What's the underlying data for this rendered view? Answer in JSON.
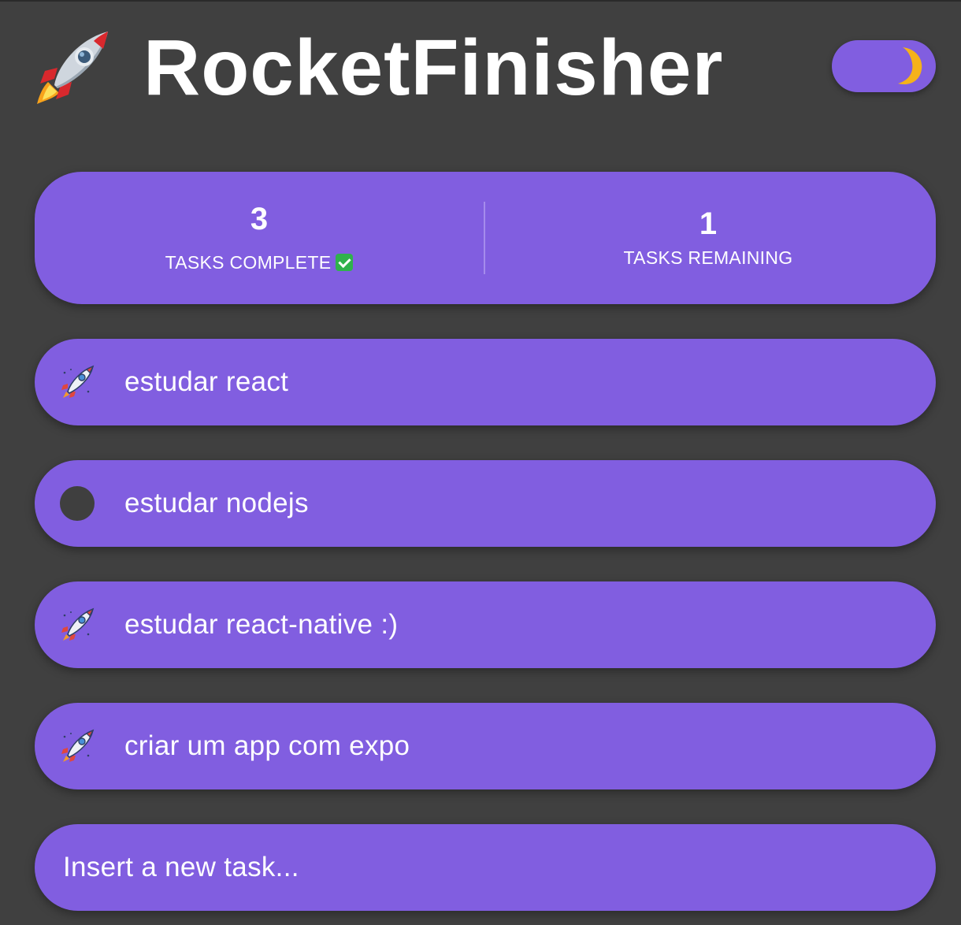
{
  "app": {
    "title": "RocketFinisher",
    "logo_icon": "rocket-icon",
    "theme_toggle_icon": "moon-icon",
    "theme": "dark"
  },
  "colors": {
    "background": "#404040",
    "accent": "#815ee0",
    "text": "#ffffff",
    "check_green": "#2fb24c",
    "moon": "#f5b21a"
  },
  "stats": {
    "complete": {
      "value": "3",
      "label": "TASKS COMPLETE",
      "icon": "check-mark-emoji"
    },
    "remaining": {
      "value": "1",
      "label": "TASKS REMAINING"
    }
  },
  "tasks": [
    {
      "text": "estudar react",
      "done": true,
      "icon": "rocket-icon"
    },
    {
      "text": "estudar nodejs",
      "done": false,
      "icon": "circle-icon"
    },
    {
      "text": "estudar react-native :)",
      "done": true,
      "icon": "rocket-icon"
    },
    {
      "text": "criar um app com expo",
      "done": true,
      "icon": "rocket-icon"
    }
  ],
  "new_task": {
    "placeholder": "Insert a new task...",
    "value": ""
  }
}
